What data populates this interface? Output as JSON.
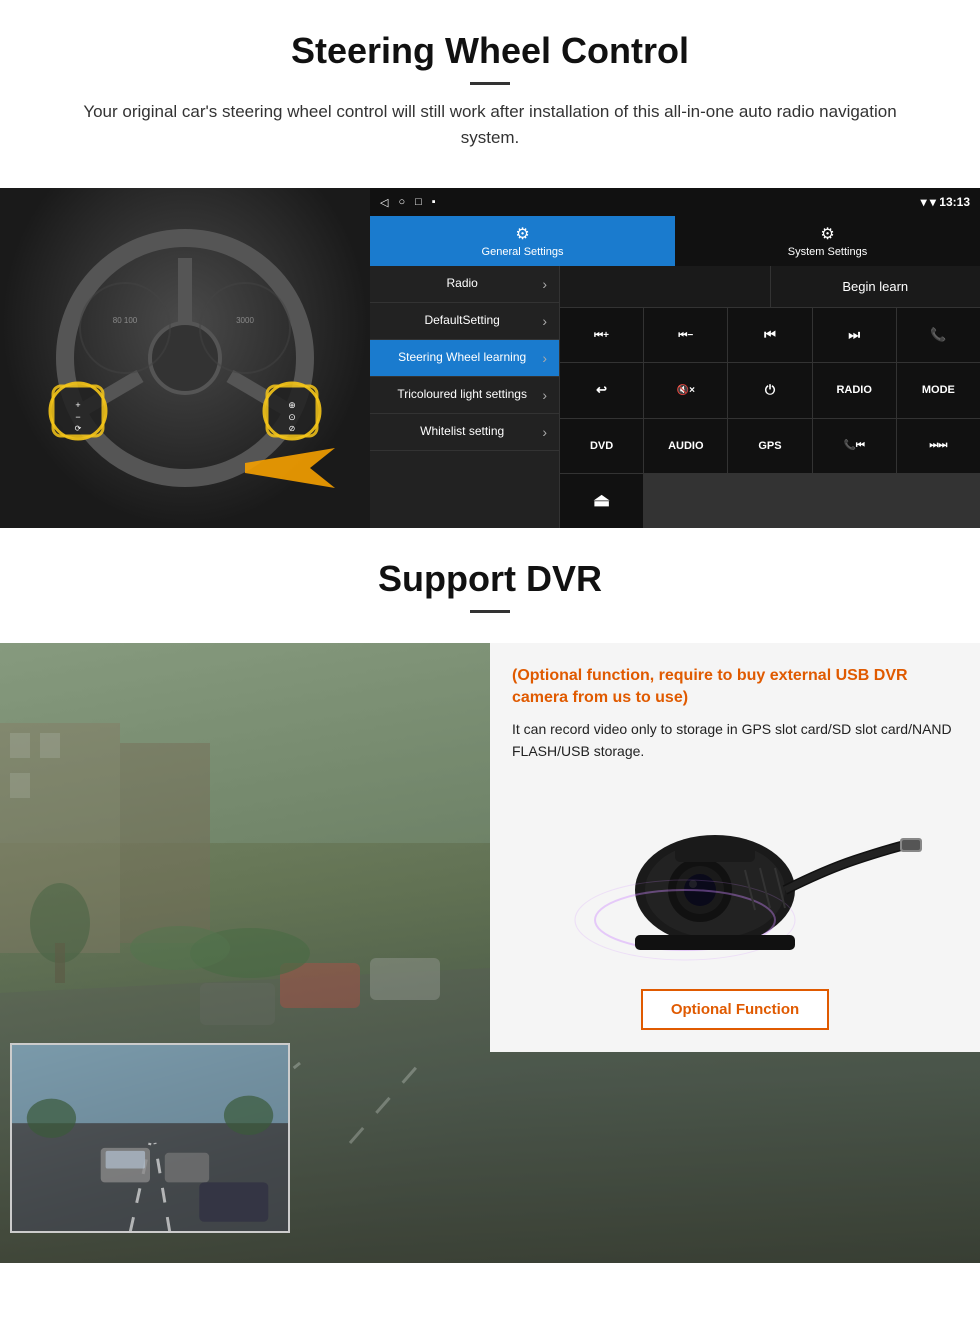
{
  "steering": {
    "title": "Steering Wheel Control",
    "description": "Your original car's steering wheel control will still work after installation of this all-in-one auto radio navigation system.",
    "android_status": {
      "back": "◁",
      "home": "○",
      "recent": "□",
      "save": "▪",
      "time": "13:13",
      "signal_icon": "▾",
      "wifi_icon": "▾"
    },
    "tabs": [
      {
        "label": "General Settings",
        "active": true
      },
      {
        "label": "System Settings",
        "active": false
      }
    ],
    "menu_items": [
      {
        "label": "Radio",
        "active": false
      },
      {
        "label": "DefaultSetting",
        "active": false
      },
      {
        "label": "Steering Wheel learning",
        "active": true
      },
      {
        "label": "Tricoloured light settings",
        "active": false
      },
      {
        "label": "Whitelist setting",
        "active": false
      }
    ],
    "begin_learn": "Begin learn",
    "ctrl_buttons": [
      "⏮+",
      "⏮-",
      "⏮⏮",
      "⏭⏭",
      "📞",
      "↩",
      "🔇×",
      "⏻",
      "RADIO",
      "MODE",
      "DVD",
      "AUDIO",
      "GPS",
      "📞⏮",
      "⏭⏭"
    ]
  },
  "dvr": {
    "title": "Support DVR",
    "optional_text": "(Optional function, require to buy external USB DVR camera from us to use)",
    "description": "It can record video only to storage in GPS slot card/SD slot card/NAND FLASH/USB storage.",
    "optional_btn_label": "Optional Function"
  }
}
